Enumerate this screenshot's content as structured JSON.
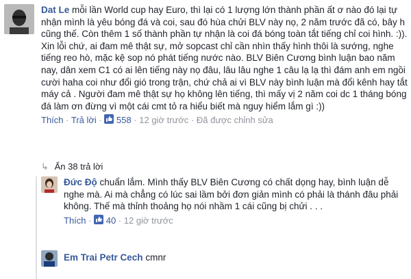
{
  "comment": {
    "author": "Dat Le",
    "text": "mỗi lần World cup hay Euro, thì lại có 1 lượng lớn thành phần ất ơ nào đó lại tự nhận mình là yêu bóng đá và coi, sau đó hùa chửi BLV này nọ, 2 năm trước đã có, bây h cũng thế. Còn thêm 1 số thành phần tự nhận là coi đá bóng toàn tắt tiếng chỉ coi hình. :)). Xin lỗi chứ, ai đam mê thật sự, mở sopcast chỉ cần nhìn thấy hình thôi là sướng, nghe tiếng reo hò, mặc kệ sop nó phát tiếng nước nào. BLV Biên Cương bình luận bao năm nay, dân xem C1 có ai lên tiếng này nọ đâu, lâu lâu nghe 1 câu lạ lạ thì đám anh em ngồi cười haha coi như đổi gió trong trận, chứ chả ai vì BLV này bình luận mà đổi kênh hay tắt máy cả . Người đam mê thật sự họ không lên tiếng, thì mấy vị 2 năm coi dc 1 tháng bóng đá làm ơn đừng vì một cái cmt tỏ ra hiểu biết mà nguy hiểm lắm gì :))",
    "like_label": "Thích",
    "reply_label": "Trả lời",
    "like_count": "558",
    "time": "12 giờ trước",
    "edited": "Đã được chỉnh sửa"
  },
  "replies_toggle": "Ẩn 38 trả lời",
  "replies": [
    {
      "author": "Đức Độ",
      "text": "chuẩn lắm. Mình thấy BLV Biên Cương có chất dọng hay, bình luận dễ nghe mà. Ai mà chẳng có lúc sai lầm bởi đơn giản mình có phải là thánh đâu phải không. Thế mà thỉnh thoảng họ nói nhầm 1 cái cũng bị chửi . . .",
      "like_label": "Thích",
      "like_count": "40",
      "time": "12 giờ trước"
    },
    {
      "author": "Em Trai Petr Cech",
      "text": "cmnr"
    }
  ],
  "colors": {
    "link": "#365899",
    "meta": "#90949c",
    "like_badge": "#4267b2"
  }
}
